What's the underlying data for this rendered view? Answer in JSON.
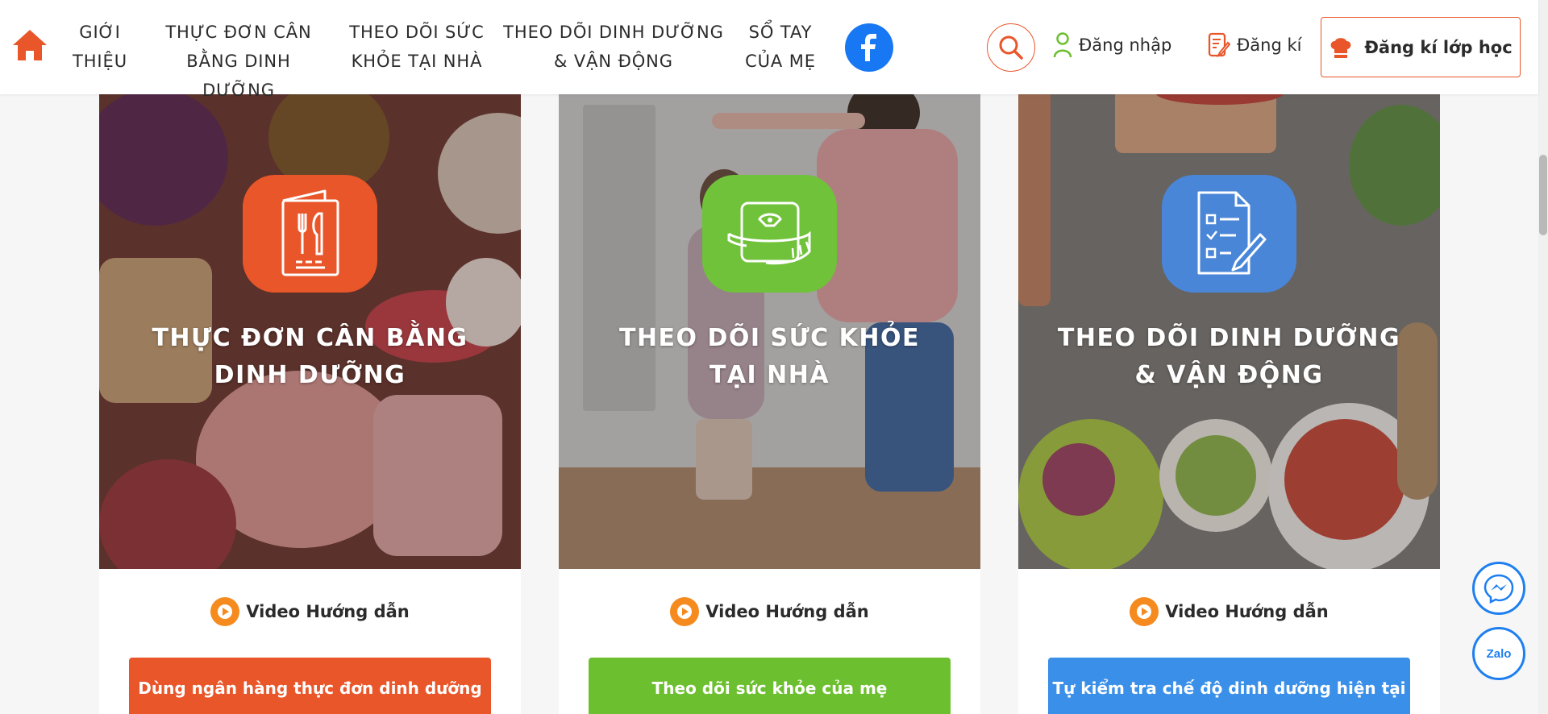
{
  "header": {
    "nav": [
      {
        "line1": "GIỚI",
        "line2": "THIỆU"
      },
      {
        "line1": "THỰC ĐƠN CÂN",
        "line2": "BẰNG DINH DƯỠNG"
      },
      {
        "line1": "THEO DÕI SỨC",
        "line2": "KHỎE TẠI NHÀ"
      },
      {
        "line1": "THEO DÕI DINH DƯỠNG",
        "line2": "& VẬN ĐỘNG"
      },
      {
        "line1": "SỔ TAY",
        "line2": "CỦA MẸ"
      }
    ],
    "login_label": "Đăng nhập",
    "register_label": "Đăng kí",
    "class_register_label": "Đăng kí lớp học"
  },
  "cards": [
    {
      "title_line1": "THỰC ĐƠN CÂN BẰNG",
      "title_line2": "DINH DƯỠNG",
      "video_label": "Video Hướng dẫn",
      "button_label": "Dùng ngân hàng thực đơn dinh dưỡng",
      "icon_color": "#e8562a",
      "button_color": "#e8562a",
      "icon": "menu-fork-knife-icon"
    },
    {
      "title_line1": "THEO DÕI SỨC KHỎE",
      "title_line2": "TẠI NHÀ",
      "video_label": "Video Hướng dẫn",
      "button_label": "Theo dõi sức khỏe của mẹ",
      "icon_color": "#6fc239",
      "button_color": "#6cbf2f",
      "icon": "scale-tape-icon"
    },
    {
      "title_line1": "THEO DÕI DINH DƯỠNG",
      "title_line2": "& VẬN ĐỘNG",
      "video_label": "Video Hướng dẫn",
      "button_label": "Tự kiểm tra chế độ dinh dưỡng hiện tại",
      "icon_color": "#4a86d8",
      "button_color": "#3a8fe8",
      "icon": "checklist-pencil-icon"
    }
  ],
  "floating": {
    "zalo_label": "Zalo"
  },
  "colors": {
    "accent": "#e8562a",
    "facebook": "#1877f2",
    "messenger": "#1e7ff0"
  }
}
